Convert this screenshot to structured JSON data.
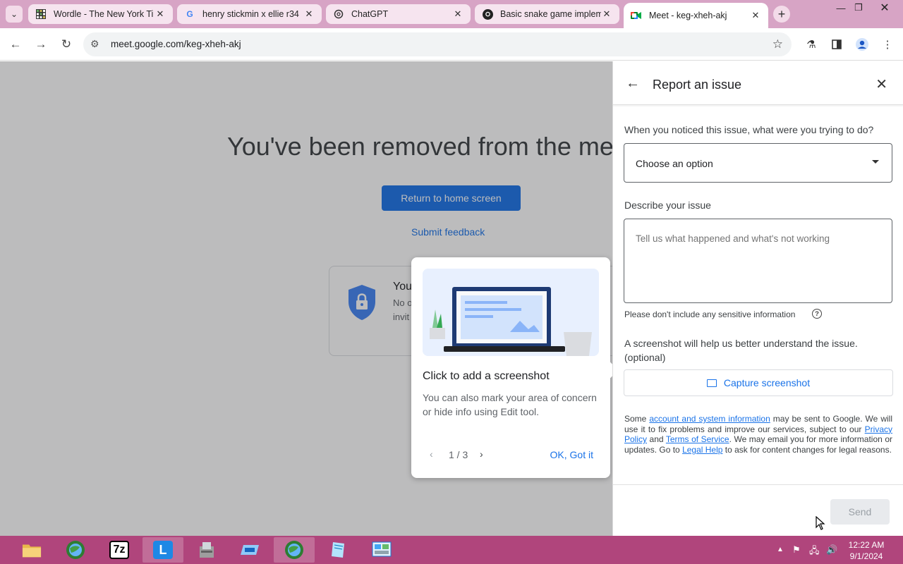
{
  "browser": {
    "tabs": [
      {
        "title": "Wordle - The New York Ti",
        "favicon": "wordle-grid-icon"
      },
      {
        "title": "henry stickmin x ellie r34",
        "favicon": "google-g-icon"
      },
      {
        "title": "ChatGPT",
        "favicon": "chatgpt-icon"
      },
      {
        "title": "Basic snake game implem",
        "favicon": "github-icon"
      },
      {
        "title": "Meet - keg-xheh-akj",
        "favicon": "meet-icon",
        "active": true
      }
    ],
    "url": "meet.google.com/keg-xheh-akj"
  },
  "meet": {
    "headline": "You've been removed from the meeting",
    "return_button": "Return to home screen",
    "feedback_link": "Submit feedback",
    "security_title": "You",
    "security_desc_1": "No o",
    "security_desc_2": "invit"
  },
  "tooltip": {
    "title": "Click to add a screenshot",
    "description": "You can also mark your area of concern or hide info using Edit tool.",
    "pager": "1 / 3",
    "ok_button": "OK, Got it"
  },
  "report": {
    "title": "Report an issue",
    "question_1": "When you noticed this issue, what were you trying to do?",
    "select_value": "Choose an option",
    "question_2": "Describe your issue",
    "textarea_placeholder": "Tell us what happened and what's not working",
    "sensitive_hint": "Please don't include any sensitive information",
    "screenshot_text": "A screenshot will help us better understand the issue. (optional)",
    "capture_button": "Capture screenshot",
    "legal": {
      "t1": "Some ",
      "l1": "account and system information",
      "t2": " may be sent to Google. We will use it to fix problems and improve our services, subject to our ",
      "l2": "Privacy Policy",
      "t3": " and ",
      "l3": "Terms of Service",
      "t4": ". We may email you for more information or updates. Go to ",
      "l4": "Legal Help",
      "t5": " to ask for content changes for legal reasons."
    },
    "send_button": "Send"
  },
  "taskbar": {
    "apps": [
      "file-explorer-icon",
      "browser-globe-icon",
      "7zip-icon",
      "lync-icon",
      "installer-icon",
      "drive-icon",
      "browser-globe-icon",
      "notepad-icon",
      "control-panel-icon"
    ],
    "seven_zip_label": "7z",
    "lync_label": "L",
    "time": "12:22 AM",
    "date": "9/1/2024"
  },
  "colors": {
    "accent": "#1a73e8",
    "taskbar": "#b0457c",
    "tabstrip": "#d7a4c5"
  }
}
